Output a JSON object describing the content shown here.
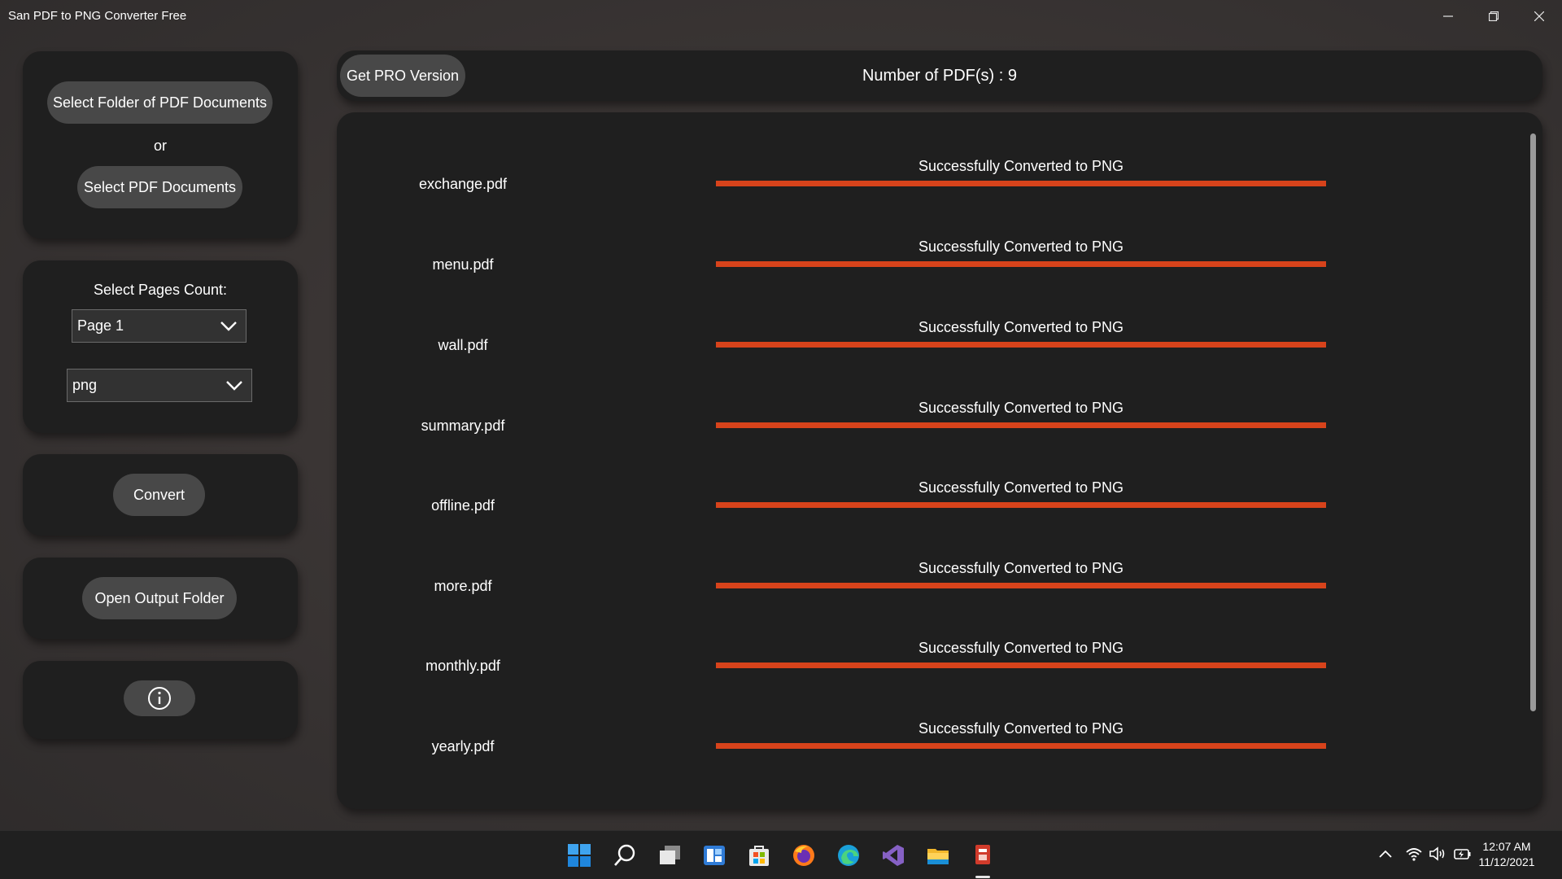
{
  "window": {
    "title": "San PDF to PNG Converter Free"
  },
  "sidebar": {
    "select_folder_label": "Select Folder of PDF Documents",
    "or_label": "or",
    "select_docs_label": "Select PDF Documents",
    "pages_count_label": "Select Pages Count:",
    "pages_selected": "Page 1",
    "format_selected": "png",
    "convert_label": "Convert",
    "open_output_label": "Open Output Folder",
    "info_icon": "info-icon"
  },
  "header": {
    "pro_label": "Get PRO Version",
    "pdf_count": "Number of PDF(s) : 9"
  },
  "files": [
    {
      "name": "exchange.pdf",
      "status": "Successfully Converted to PNG",
      "progress": 1.0
    },
    {
      "name": "menu.pdf",
      "status": "Successfully Converted to PNG",
      "progress": 1.0
    },
    {
      "name": "wall.pdf",
      "status": "Successfully Converted to PNG",
      "progress": 1.0
    },
    {
      "name": "summary.pdf",
      "status": "Successfully Converted to PNG",
      "progress": 1.0
    },
    {
      "name": "offline.pdf",
      "status": "Successfully Converted to PNG",
      "progress": 1.0
    },
    {
      "name": "more.pdf",
      "status": "Successfully Converted to PNG",
      "progress": 1.0
    },
    {
      "name": "monthly.pdf",
      "status": "Successfully Converted to PNG",
      "progress": 1.0
    },
    {
      "name": "yearly.pdf",
      "status": "Successfully Converted to PNG",
      "progress": 1.0
    }
  ],
  "colors": {
    "progress": "#d7431b",
    "card": "#1f1f1f",
    "pill": "#484848"
  },
  "taskbar": {
    "icons": [
      "windows-start-icon",
      "search-icon",
      "task-view-icon",
      "widgets-icon",
      "store-icon",
      "firefox-icon",
      "edge-icon",
      "visual-studio-icon",
      "file-explorer-icon",
      "pdf-converter-app-icon"
    ],
    "tray_icons": [
      "chevron-up-icon",
      "wifi-icon",
      "volume-icon",
      "battery-icon"
    ],
    "time": "12:07 AM",
    "date": "11/12/2021"
  }
}
